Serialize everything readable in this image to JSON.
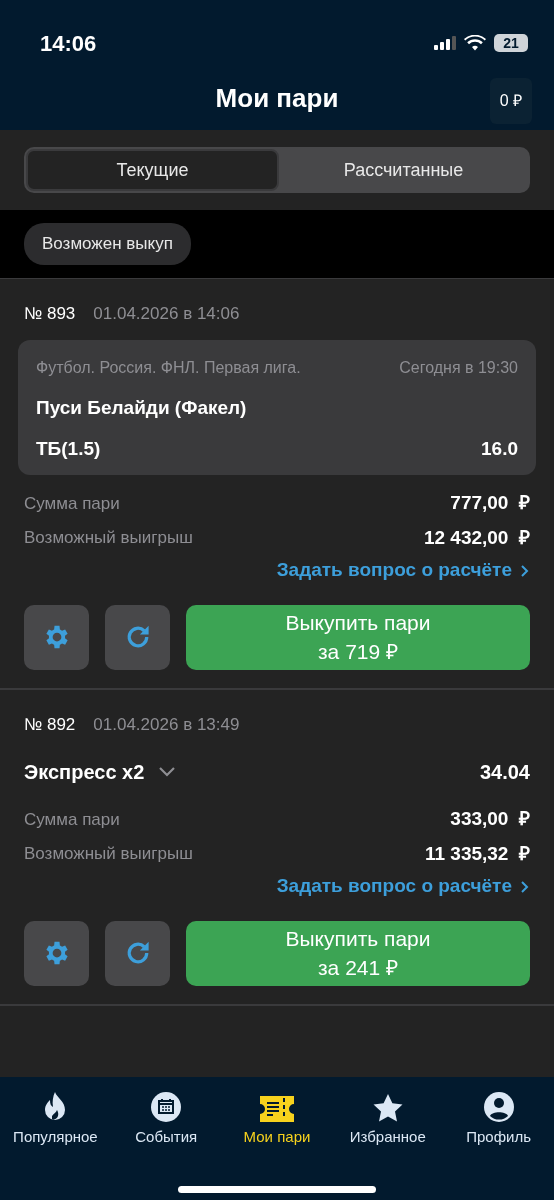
{
  "status_bar": {
    "time": "14:06",
    "battery": "21"
  },
  "header": {
    "title": "Мои пари",
    "balance": "0 ₽"
  },
  "tabs": [
    {
      "label": "Текущие",
      "selected": true
    },
    {
      "label": "Рассчитанные",
      "selected": false
    }
  ],
  "filters": [
    {
      "label": "Возможен выкуп"
    }
  ],
  "bets": [
    {
      "kind": "single",
      "number": "№ 893",
      "date": "01.04.2026 в 14:06",
      "event": {
        "league": "Футбол. Россия. ФНЛ. Первая лига.",
        "time": "Сегодня в 19:30",
        "name": "Пуси Белайди (Факел)",
        "market": "ТБ(1.5)",
        "odds": "16.0"
      },
      "stake_label": "Сумма пари",
      "stake": "777,00",
      "win_label": "Возможный выигрыш",
      "win": "12 432,00",
      "currency": "₽",
      "question_link": "Задать вопрос о расчёте",
      "cashout_label": "Выкупить пари",
      "cashout_amount": "за  719 ₽"
    },
    {
      "kind": "express",
      "number": "№ 892",
      "date": "01.04.2026 в 13:49",
      "express": {
        "title": "Экспресс x2",
        "odds": "34.04",
        "expanded": false
      },
      "stake_label": "Сумма пари",
      "stake": "333,00",
      "win_label": "Возможный выигрыш",
      "win": "11 335,32",
      "currency": "₽",
      "question_link": "Задать вопрос о расчёте",
      "cashout_label": "Выкупить пари",
      "cashout_amount": "за  241 ₽"
    }
  ],
  "nav": [
    {
      "kind": "fire",
      "label": "Популярное",
      "selected": false
    },
    {
      "kind": "calendar",
      "label": "События",
      "selected": false
    },
    {
      "kind": "ticket",
      "label": "Мои пари",
      "selected": true
    },
    {
      "kind": "star",
      "label": "Избранное",
      "selected": false
    },
    {
      "kind": "profile",
      "label": "Профиль",
      "selected": false
    }
  ]
}
